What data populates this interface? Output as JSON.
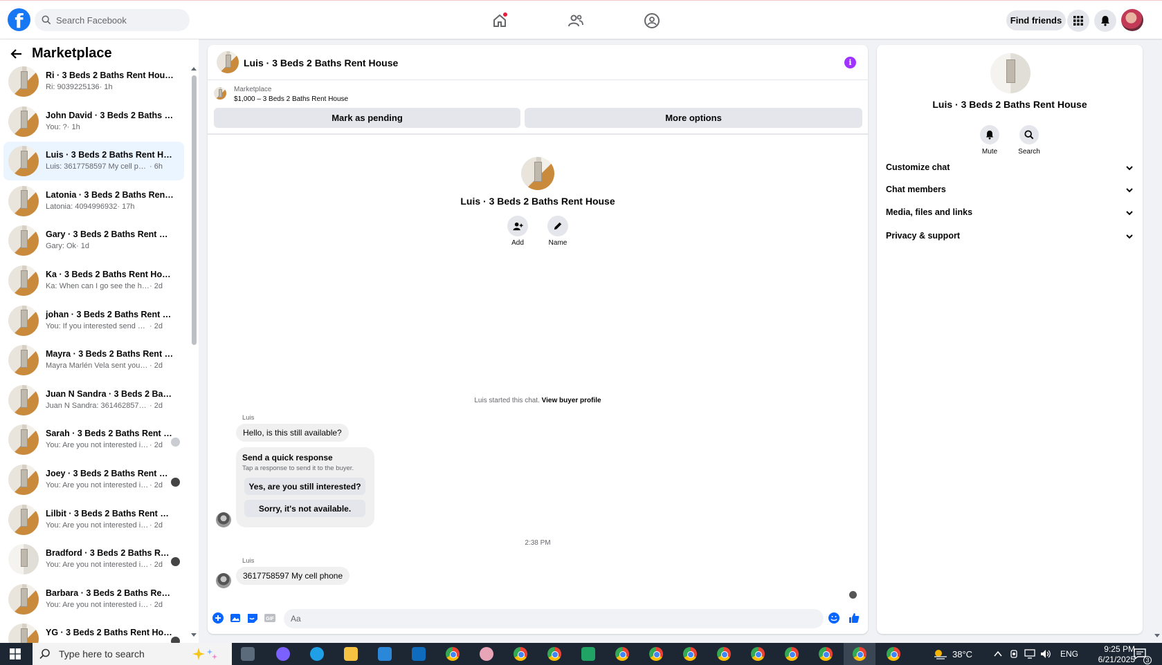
{
  "topbar": {
    "logo": "f",
    "search_placeholder": "Search Facebook",
    "find_friends": "Find friends",
    "icons": [
      "home-icon",
      "friends-icon",
      "groups-icon",
      "menu-grid-icon",
      "bell-icon"
    ]
  },
  "sidebar": {
    "title": "Marketplace",
    "conversations": [
      {
        "name": "Ri · 3 Beds 2 Baths Rent House",
        "preview": "Ri: 9039225136",
        "time": "· 1h",
        "seen": ""
      },
      {
        "name": "John David · 3 Beds 2 Baths Ren...",
        "preview": "You: ?",
        "time": "· 1h",
        "seen": ""
      },
      {
        "name": "Luis · 3 Beds 2 Baths Rent House",
        "preview": "Luis: 3617758597 My cell phone",
        "time": "· 6h",
        "seen": "",
        "active": true
      },
      {
        "name": "Latonia · 3 Beds 2 Baths Rent H...",
        "preview": "Latonia: 4094996932",
        "time": "· 17h",
        "seen": ""
      },
      {
        "name": "Gary · 3 Beds 2 Baths Rent House",
        "preview": "Gary: Ok",
        "time": "· 1d",
        "seen": ""
      },
      {
        "name": "Ka · 3 Beds 2 Baths Rent House",
        "preview": "Ka: When can I go see the house",
        "time": "· 2d",
        "seen": ""
      },
      {
        "name": "johan · 3 Beds 2 Baths Rent Ho...",
        "preview": "You: If you interested send me you...",
        "time": "· 2d",
        "seen": ""
      },
      {
        "name": "Mayra · 3 Beds 2 Baths Rent Ho...",
        "preview": "Mayra Marlén Vela sent you a mes...",
        "time": "· 2d",
        "seen": ""
      },
      {
        "name": "Juan N Sandra · 3 Beds 2 Baths ...",
        "preview": "Juan N Sandra: 3614628570. Text ...",
        "time": "· 2d",
        "seen": ""
      },
      {
        "name": "Sarah · 3 Beds 2 Baths Rent H...",
        "preview": "You: Are you not interested in t...",
        "time": "· 2d",
        "seen": "light"
      },
      {
        "name": "Joey · 3 Beds 2 Baths Rent Ho...",
        "preview": "You: Are you not interested in t...",
        "time": "· 2d",
        "seen": "dark"
      },
      {
        "name": "Lilbit · 3 Beds 2 Baths Rent House",
        "preview": "You: Are you not interested in this ...",
        "time": "· 2d",
        "seen": ""
      },
      {
        "name": "Bradford · 3 Beds 2 Baths Ren...",
        "preview": "You: Are you not interested in t...",
        "time": "· 2d",
        "seen": "dark"
      },
      {
        "name": "Barbara · 3 Beds 2 Baths Rent H...",
        "preview": "You: Are you not interested in this ...",
        "time": "· 2d",
        "seen": ""
      },
      {
        "name": "YG · 3 Beds 2 Baths Rent House",
        "preview": "",
        "time": "",
        "seen": "dark"
      }
    ]
  },
  "chat": {
    "title": "Luis · 3 Beds 2 Baths Rent House",
    "listing_label": "Marketplace",
    "listing_detail": "$1,000 – 3 Beds 2 Baths Rent House",
    "mark_pending": "Mark as pending",
    "more_options": "More options",
    "center_name": "Luis · 3 Beds 2 Baths Rent House",
    "add_label": "Add",
    "name_label": "Name",
    "started_text": "Luis started this chat.",
    "view_buyer": "View buyer profile",
    "sender1": "Luis",
    "msg1": "Hello, is this still available?",
    "quick_title": "Send a quick response",
    "quick_sub": "Tap a response to send it to the buyer.",
    "quick_yes": "Yes, are you still interested?",
    "quick_no": "Sorry, it's not available.",
    "timestamp": "2:38 PM",
    "sender2": "Luis",
    "msg2": "3617758597 My cell phone",
    "composer_placeholder": "Aa"
  },
  "rpanel": {
    "name": "Luis · 3 Beds 2 Baths Rent House",
    "mute": "Mute",
    "search": "Search",
    "rows": [
      "Customize chat",
      "Chat members",
      "Media, files and links",
      "Privacy & support"
    ]
  },
  "taskbar": {
    "search_placeholder": "Type here to search",
    "temperature": "38°C",
    "language": "ENG",
    "time": "9:25 PM",
    "date": "6/21/2025",
    "notifications": "3"
  },
  "colors": {
    "brand": "#1877f2",
    "active_row": "#ebf5ff",
    "info": "#a033ff"
  }
}
